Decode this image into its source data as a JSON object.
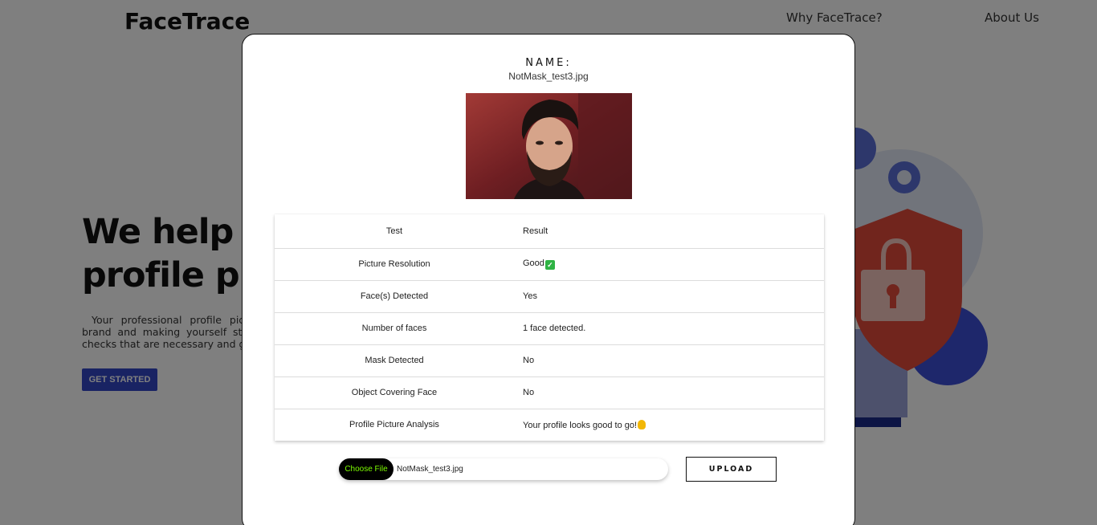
{
  "header": {
    "brand": "FaceTrace",
    "nav": [
      "Why FaceTrace?",
      "About Us"
    ]
  },
  "hero": {
    "title_line1": "We help yo",
    "title_line2": "profile pic",
    "text": "Your professional profile pictu brand and making yourself stan checks that are necessary and giv",
    "cta": "GET STARTED"
  },
  "modal": {
    "name_label": "NAME:",
    "file_name": "NotMask_test3.jpg",
    "table": {
      "headers": [
        "Test",
        "Result"
      ],
      "rows": [
        {
          "test": "Picture Resolution",
          "result": "Good",
          "icon": "check-mark-emoji"
        },
        {
          "test": "Face(s) Detected",
          "result": "Yes"
        },
        {
          "test": "Number of faces",
          "result": "1 face detected."
        },
        {
          "test": "Mask Detected",
          "result": "No"
        },
        {
          "test": "Object Covering Face",
          "result": "No"
        },
        {
          "test": "Profile Picture Analysis",
          "result": "Your profile looks good to go!",
          "icon": "ok-hand-emoji"
        }
      ]
    },
    "choose_file_label": "Choose File",
    "chosen_file": "NotMask_test3.jpg",
    "upload_label": "UPLOAD"
  },
  "colors": {
    "accent": "#3346c7",
    "choose_file_text": "#7CFC00",
    "overlay": "rgba(0,0,0,0.5)"
  }
}
